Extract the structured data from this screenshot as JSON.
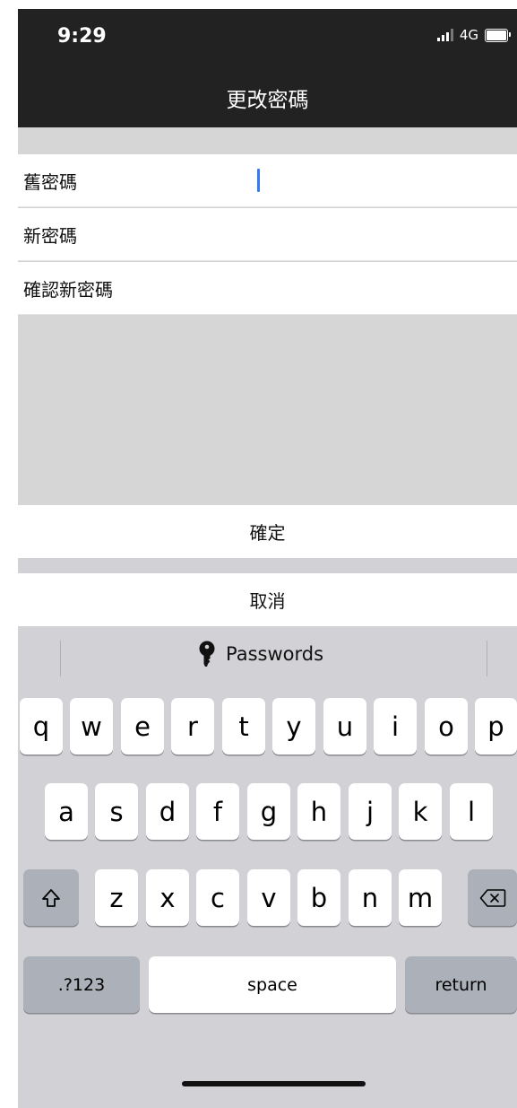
{
  "status": {
    "time": "9:29",
    "network": "4G"
  },
  "nav": {
    "title": "更改密碼"
  },
  "form": {
    "fields": [
      {
        "label": "舊密碼"
      },
      {
        "label": "新密碼"
      },
      {
        "label": "確認新密碼"
      }
    ],
    "confirm_label": "確定",
    "cancel_label": "取消"
  },
  "keyboard": {
    "passwords_label": "Passwords",
    "row1": [
      "q",
      "w",
      "e",
      "r",
      "t",
      "y",
      "u",
      "i",
      "o",
      "p"
    ],
    "row2": [
      "a",
      "s",
      "d",
      "f",
      "g",
      "h",
      "j",
      "k",
      "l"
    ],
    "row3": [
      "z",
      "x",
      "c",
      "v",
      "b",
      "n",
      "m"
    ],
    "numbers_label": ".?123",
    "space_label": "space",
    "return_label": "return",
    "icons": {
      "shift": "shift-icon",
      "delete": "delete-icon",
      "key": "key-icon"
    }
  },
  "colors": {
    "nav_bg": "#222222",
    "cursor": "#3478f6",
    "keyboard_bg": "#d1d1d6"
  }
}
